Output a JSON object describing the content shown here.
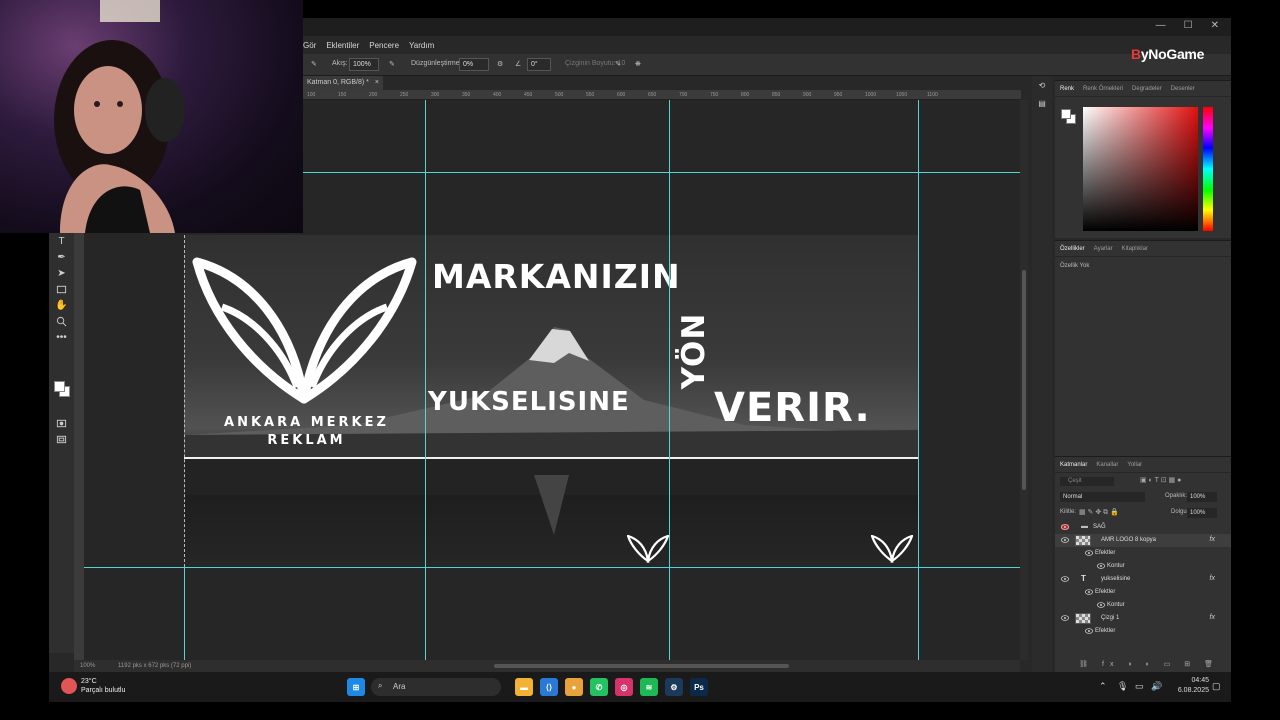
{
  "window": {
    "controls": [
      "—",
      "☐",
      "✕"
    ]
  },
  "menu": {
    "items": [
      "Gör",
      "Eklentiler",
      "Pencere",
      "Yardım"
    ]
  },
  "options": {
    "akis_label": "Akış:",
    "akis_value": "100%",
    "duzgunlestirme_label": "Düzgünleştirme:",
    "duzgunlestirme_value": "0%",
    "angle_value": "0°",
    "size_label": "Çizginin Boyutu: 10"
  },
  "document": {
    "tab_label": "Katman 0, RGB/8) *",
    "close": "×"
  },
  "ruler": {
    "ticks": [
      "100",
      "150",
      "200",
      "250",
      "300",
      "350",
      "400",
      "450",
      "500",
      "550",
      "600",
      "650",
      "700",
      "750",
      "800",
      "850",
      "900",
      "950",
      "1000",
      "1050",
      "1100"
    ]
  },
  "artwork": {
    "headline1": "MARKANIZIN",
    "headline2": "YUKSELISINE",
    "headline3": "YÖN",
    "headline4": "VERIR.",
    "brand_line1": "ANKARA MERKEZ",
    "brand_line2": "REKLAM"
  },
  "statusbar": {
    "zoom": "100%",
    "dimensions": "1192 pks x 672 pks (72 ppi)"
  },
  "panels": {
    "color_tabs": [
      "Renk",
      "Renk Örnekleri",
      "Degradeler",
      "Desenler"
    ],
    "properties_tabs": [
      "Özellikler",
      "Ayarlar",
      "Kitaplıklar"
    ],
    "properties_empty": "Özellik Yok",
    "layers_tabs": [
      "Katmanlar",
      "Kanallar",
      "Yollar"
    ],
    "search_placeholder": "Çeşit",
    "blend_mode": "Normal",
    "opacity_label": "Opaklık:",
    "opacity_value": "100%",
    "lock_label": "Kilitle:",
    "fill_label": "Dolgu:",
    "fill_value": "100%",
    "layers": [
      {
        "name": "SAĞ",
        "kind": "group"
      },
      {
        "name": "AMR LOGO 8 kopya",
        "kind": "image",
        "fx": "fx",
        "selected": true
      },
      {
        "name": "Efektler",
        "kind": "effect"
      },
      {
        "name": "Kontur",
        "kind": "effect-item"
      },
      {
        "name": "yukselisine",
        "kind": "text",
        "fx": "fx",
        "type_glyph": "T"
      },
      {
        "name": "Efektler",
        "kind": "effect"
      },
      {
        "name": "Kontur",
        "kind": "effect-item"
      },
      {
        "name": "Çizgi 1",
        "kind": "image",
        "fx": "fx"
      },
      {
        "name": "Efektler",
        "kind": "effect"
      }
    ]
  },
  "overlay": {
    "brand_prefix": "B",
    "brand_text": "yNoGame"
  },
  "taskbar": {
    "weather_temp": "23°C",
    "weather_desc": "Parçalı bulutlu",
    "search_label": "Ara",
    "apps": [
      {
        "name": "explorer",
        "color": "#f2b233",
        "glyph": "▬"
      },
      {
        "name": "vscode",
        "color": "#2b79d6",
        "glyph": "⟨⟩"
      },
      {
        "name": "chrome",
        "color": "#e8a33a",
        "glyph": "●"
      },
      {
        "name": "whatsapp",
        "color": "#25c263",
        "glyph": "✆"
      },
      {
        "name": "instagram",
        "color": "#d6336c",
        "glyph": "◎"
      },
      {
        "name": "spotify",
        "color": "#1db954",
        "glyph": "≋"
      },
      {
        "name": "steam",
        "color": "#1b3a5a",
        "glyph": "⚙"
      },
      {
        "name": "photoshop",
        "color": "#0b2a4a",
        "glyph": "Ps"
      }
    ],
    "time": "04:45",
    "date": "6.08.2025"
  }
}
